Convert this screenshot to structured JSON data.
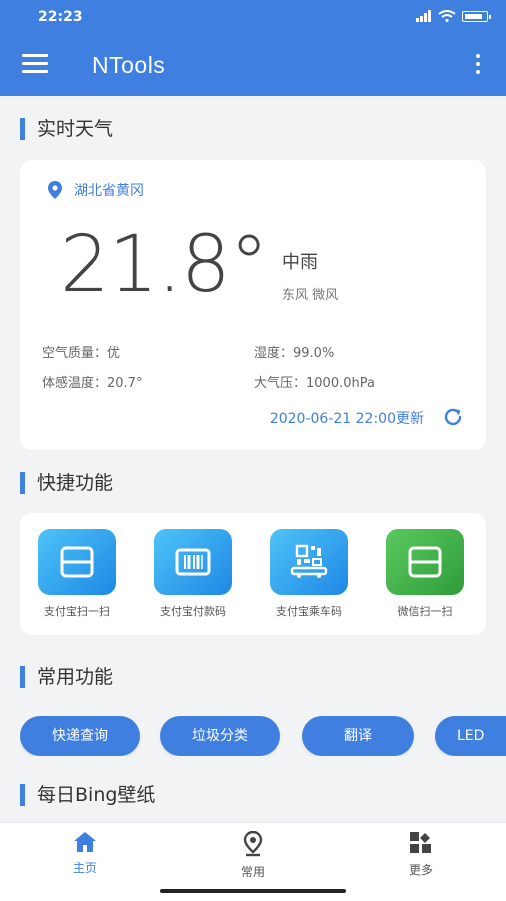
{
  "status_bar": {
    "time": "22:23"
  },
  "app_bar": {
    "title": "NTools"
  },
  "sections": {
    "weather": "实时天气",
    "quick": "快捷功能",
    "common": "常用功能",
    "bing": "每日Bing壁纸"
  },
  "weather": {
    "location": "湖北省黄冈",
    "temperature": "21.8°",
    "condition": "中雨",
    "wind": "东风   微风",
    "air_quality": "空气质量：优",
    "humidity": "湿度：99.0%",
    "feels_like": "体感温度：20.7°",
    "pressure": "大气压：1000.0hPa",
    "updated": "2020-06-21 22:00更新"
  },
  "quick_functions": [
    {
      "label": "支付宝扫一扫",
      "icon": "scan-icon",
      "color": "#2196f3"
    },
    {
      "label": "支付宝付款码",
      "icon": "barcode-icon",
      "color": "#2196f3"
    },
    {
      "label": "支付宝乘车码",
      "icon": "bus-code-icon",
      "color": "#2196f3"
    },
    {
      "label": "微信扫一扫",
      "icon": "scan-icon",
      "color": "#34a853"
    }
  ],
  "common_functions": [
    "快递查询",
    "垃圾分类",
    "翻译",
    "LED"
  ],
  "bottom_nav": [
    {
      "label": "主页",
      "icon": "home-icon",
      "active": true
    },
    {
      "label": "常用",
      "icon": "location-icon",
      "active": false
    },
    {
      "label": "更多",
      "icon": "apps-icon",
      "active": false
    }
  ],
  "colors": {
    "primary": "#3f7fe0",
    "alipay": "#2196f3",
    "wechat": "#34a853"
  }
}
